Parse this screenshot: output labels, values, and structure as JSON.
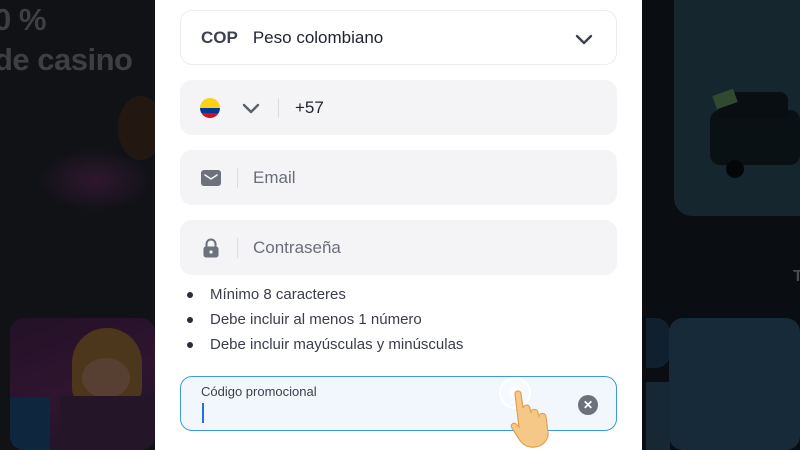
{
  "background": {
    "heading_line1": "0 %",
    "heading_line2": "de casino",
    "right_text": "T"
  },
  "registration": {
    "currency": {
      "code": "COP",
      "name": "Peso colombiano",
      "dropdown_icon": "chevron-down-icon"
    },
    "phone": {
      "country_flag": "colombia-flag-icon",
      "dial_code": "+57",
      "dropdown_icon": "chevron-down-icon"
    },
    "email": {
      "icon": "envelope-icon",
      "placeholder": "Email"
    },
    "password": {
      "icon": "lock-icon",
      "placeholder": "Contraseña"
    },
    "password_rules": [
      "Mínimo 8 caracteres",
      "Debe incluir al menos 1 número",
      "Debe incluir mayúsculas y minúsculas"
    ],
    "promo_code": {
      "label": "Código promocional",
      "value": "",
      "clear_icon": "clear-x-icon"
    }
  },
  "colors": {
    "focus_border": "#3b9ae1",
    "field_background": "#f4f4f6",
    "icon_gray": "#6d717c"
  }
}
